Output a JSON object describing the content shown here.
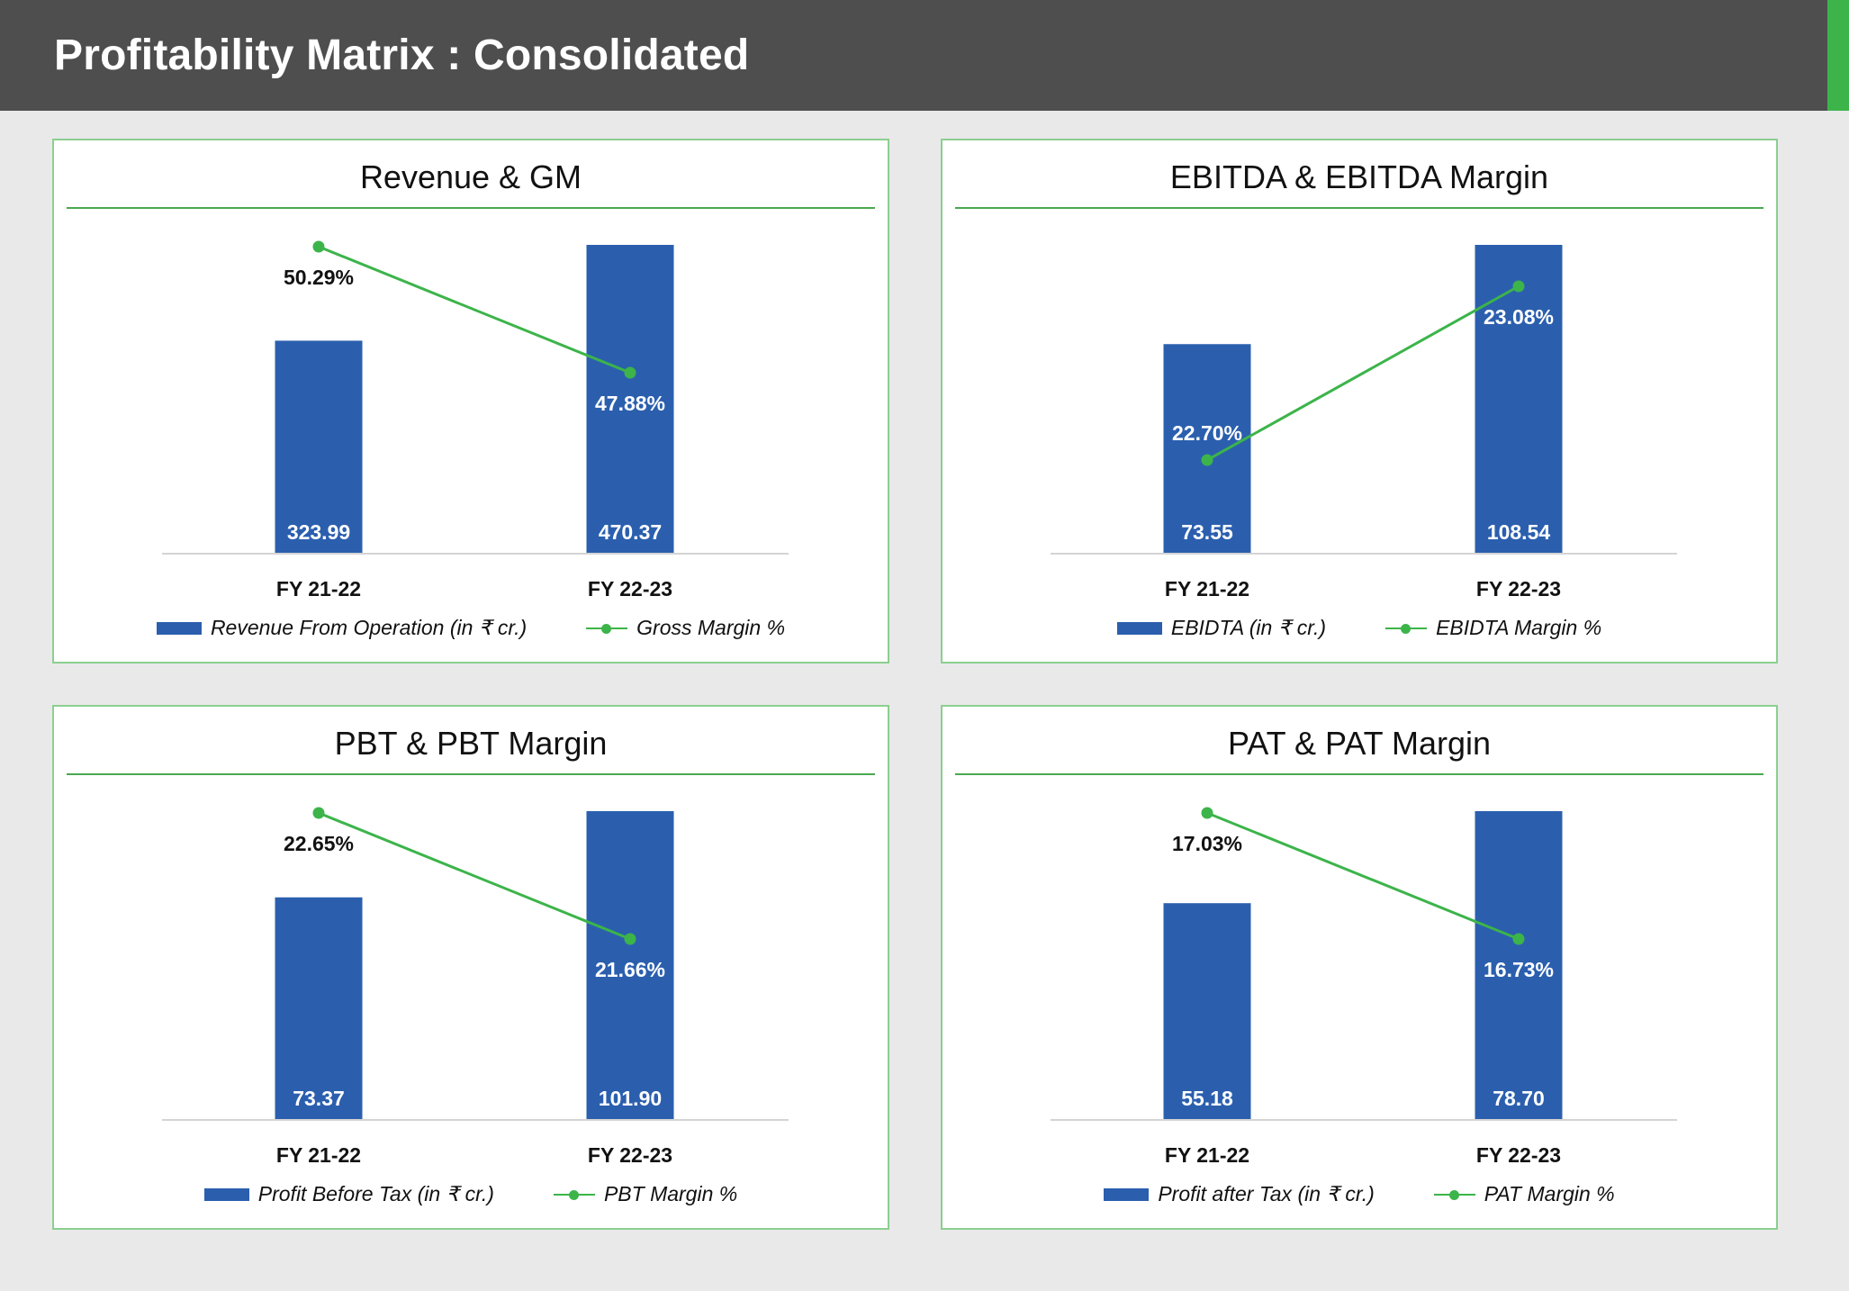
{
  "header": {
    "title": "Profitability Matrix : Consolidated"
  },
  "colors": {
    "bar": "#2b5fae",
    "line": "#3cb44a",
    "header_bg": "#4e4e4e",
    "accent": "#3cb44a"
  },
  "chart_data": [
    {
      "type": "bar+line",
      "title": "Revenue & GM",
      "categories": [
        "FY 21-22",
        "FY 22-23"
      ],
      "series": [
        {
          "name": "Revenue From Operation (in ₹ cr.)",
          "kind": "bar",
          "values": [
            323.99,
            470.37
          ],
          "labels": [
            "323.99",
            "470.37"
          ]
        },
        {
          "name": "Gross Margin %",
          "kind": "line",
          "values": [
            50.29,
            47.88
          ],
          "labels": [
            "50.29%",
            "47.88%"
          ]
        }
      ]
    },
    {
      "type": "bar+line",
      "title": "EBITDA & EBITDA Margin",
      "categories": [
        "FY 21-22",
        "FY 22-23"
      ],
      "series": [
        {
          "name": "EBIDTA (in ₹ cr.)",
          "kind": "bar",
          "values": [
            73.55,
            108.54
          ],
          "labels": [
            "73.55",
            "108.54"
          ]
        },
        {
          "name": "EBIDTA Margin %",
          "kind": "line",
          "values": [
            22.7,
            23.08
          ],
          "labels": [
            "22.70%",
            "23.08%"
          ]
        }
      ]
    },
    {
      "type": "bar+line",
      "title": "PBT & PBT Margin",
      "categories": [
        "FY 21-22",
        "FY 22-23"
      ],
      "series": [
        {
          "name": "Profit Before Tax (in ₹ cr.)",
          "kind": "bar",
          "values": [
            73.37,
            101.9
          ],
          "labels": [
            "73.37",
            "101.90"
          ]
        },
        {
          "name": "PBT Margin %",
          "kind": "line",
          "values": [
            22.65,
            21.66
          ],
          "labels": [
            "22.65%",
            "21.66%"
          ]
        }
      ]
    },
    {
      "type": "bar+line",
      "title": "PAT & PAT Margin",
      "categories": [
        "FY 21-22",
        "FY 22-23"
      ],
      "series": [
        {
          "name": "Profit after Tax (in ₹ cr.)",
          "kind": "bar",
          "values": [
            55.18,
            78.7
          ],
          "labels": [
            "55.18",
            "78.70"
          ]
        },
        {
          "name": "PAT Margin %",
          "kind": "line",
          "values": [
            17.03,
            16.73
          ],
          "labels": [
            "17.03%",
            "16.73%"
          ]
        }
      ]
    }
  ]
}
